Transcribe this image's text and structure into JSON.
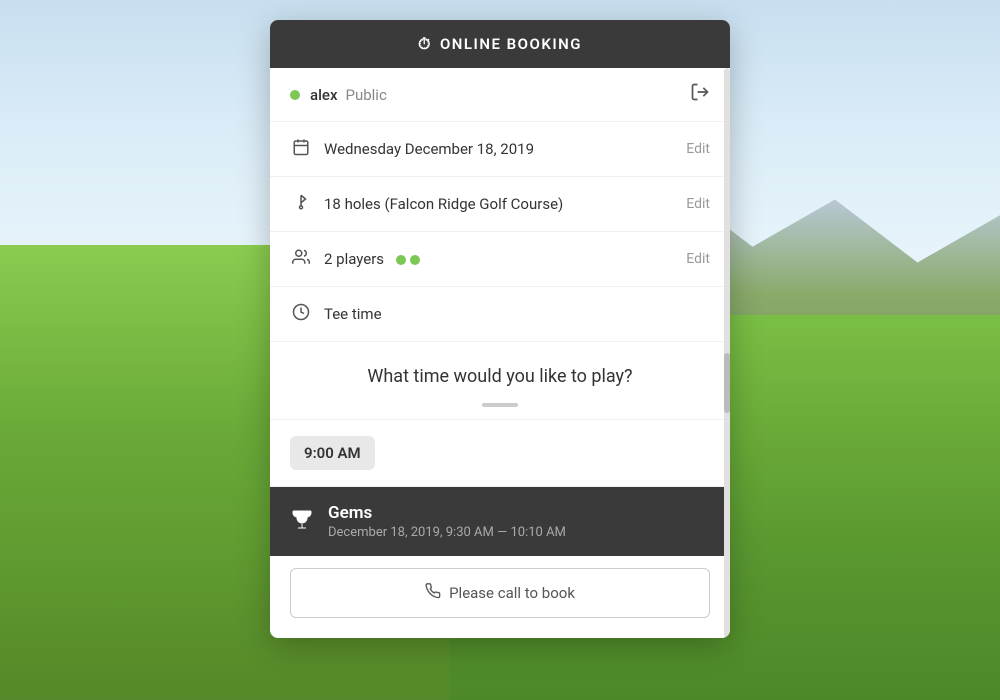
{
  "header": {
    "title": "ONLINE BOOKING",
    "clock_symbol": "🕐"
  },
  "user_row": {
    "dot_color": "#7dc855",
    "username": "alex",
    "visibility": "Public",
    "logout_symbol": "⊟"
  },
  "date_row": {
    "icon_symbol": "📅",
    "value": "Wednesday December 18, 2019",
    "edit_label": "Edit"
  },
  "holes_row": {
    "icon_symbol": "⛳",
    "value": "18 holes (Falcon Ridge Golf Course)",
    "edit_label": "Edit"
  },
  "players_row": {
    "icon_symbol": "👤",
    "value": "2 players",
    "dot_color": "#7dc855",
    "edit_label": "Edit"
  },
  "tee_time_row": {
    "icon_symbol": "🕐",
    "label": "Tee time"
  },
  "question": {
    "text": "What time would you like to play?"
  },
  "time_filter": {
    "value": "9:00 AM"
  },
  "booking_card": {
    "icon_symbol": "🏆",
    "title": "Gems",
    "subtitle": "December 18, 2019, 9:30 AM — 10:10 AM"
  },
  "call_button": {
    "phone_symbol": "📞",
    "label": "Please call to book"
  },
  "colors": {
    "header_bg": "#3a3a3a",
    "dot_green": "#7dc855",
    "edit_gray": "#999",
    "card_bg": "#3a3a3a"
  }
}
